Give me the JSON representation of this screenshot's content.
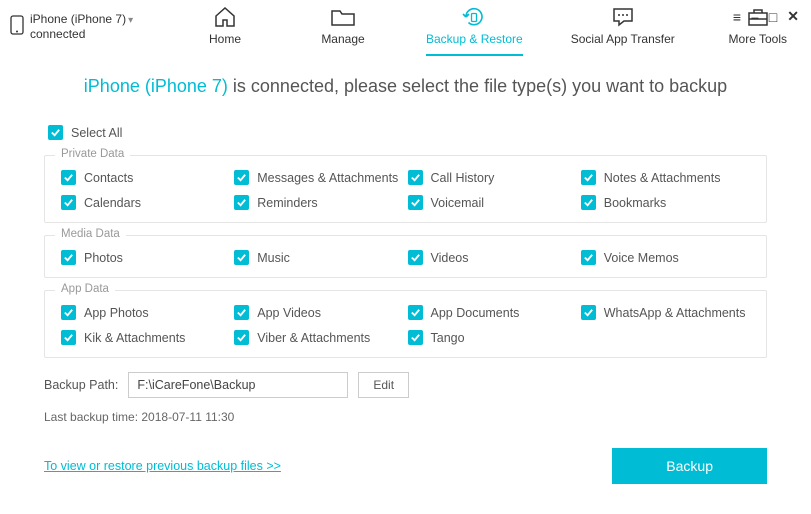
{
  "device": {
    "name": "iPhone (iPhone 7)",
    "status": "connected"
  },
  "tabs": {
    "home": "Home",
    "manage": "Manage",
    "backup": "Backup & Restore",
    "social": "Social App Transfer",
    "tools": "More Tools"
  },
  "headline": {
    "prefix": "iPhone (iPhone 7)",
    "suffix": " is connected, please select the file type(s) you want to backup"
  },
  "selectAll": "Select All",
  "groups": {
    "private": {
      "title": "Private Data",
      "items": [
        "Contacts",
        "Messages & Attachments",
        "Call History",
        "Notes & Attachments",
        "Calendars",
        "Reminders",
        "Voicemail",
        "Bookmarks"
      ]
    },
    "media": {
      "title": "Media Data",
      "items": [
        "Photos",
        "Music",
        "Videos",
        "Voice Memos"
      ]
    },
    "app": {
      "title": "App Data",
      "items": [
        "App Photos",
        "App Videos",
        "App Documents",
        "WhatsApp & Attachments",
        "Kik & Attachments",
        "Viber & Attachments",
        "Tango"
      ]
    }
  },
  "path": {
    "label": "Backup Path:",
    "value": "F:\\iCareFone\\Backup",
    "edit": "Edit"
  },
  "lastBackup": "Last backup time: 2018-07-11 11:30",
  "restoreLink": "To view or restore previous backup files >>",
  "backupBtn": "Backup",
  "colors": {
    "accent": "#00bcd4"
  }
}
